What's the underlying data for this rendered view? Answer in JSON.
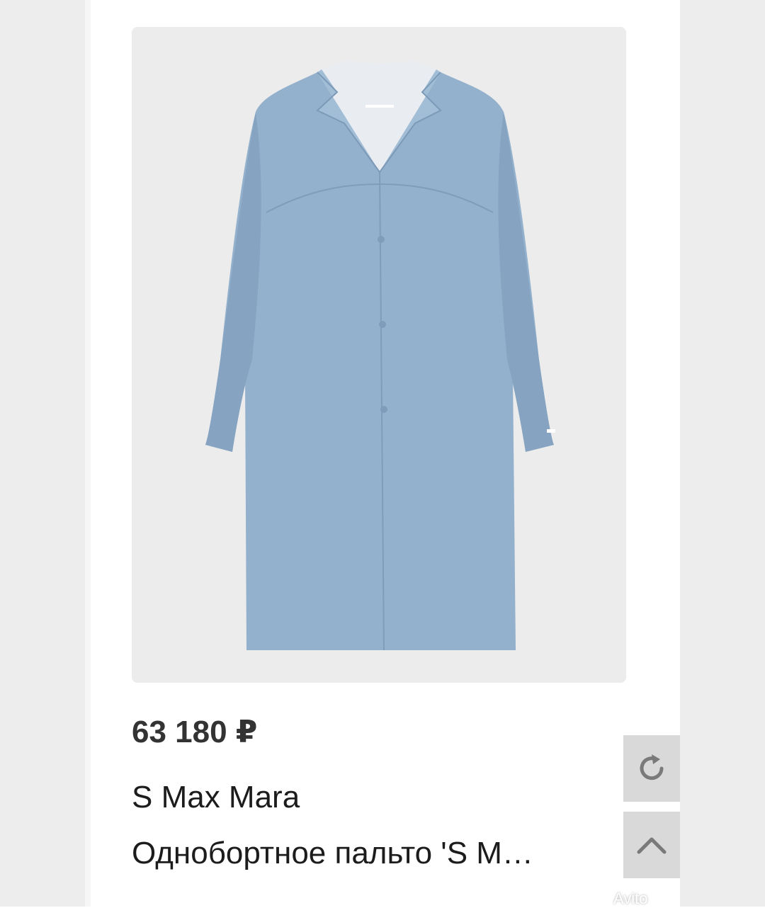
{
  "product": {
    "price": "63 180 ₽",
    "brand": "S Max Mara",
    "title": "Однобортное пальто 'S M…",
    "image_alt": "coat-photo",
    "image_bg": "#ececec",
    "coat_color": "#93b0cc"
  },
  "actions": {
    "favorite_icon": "heart-outline-icon",
    "refresh_icon": "refresh-icon",
    "scroll_up_icon": "chevron-up-icon"
  },
  "watermark": {
    "text": "Avito"
  }
}
